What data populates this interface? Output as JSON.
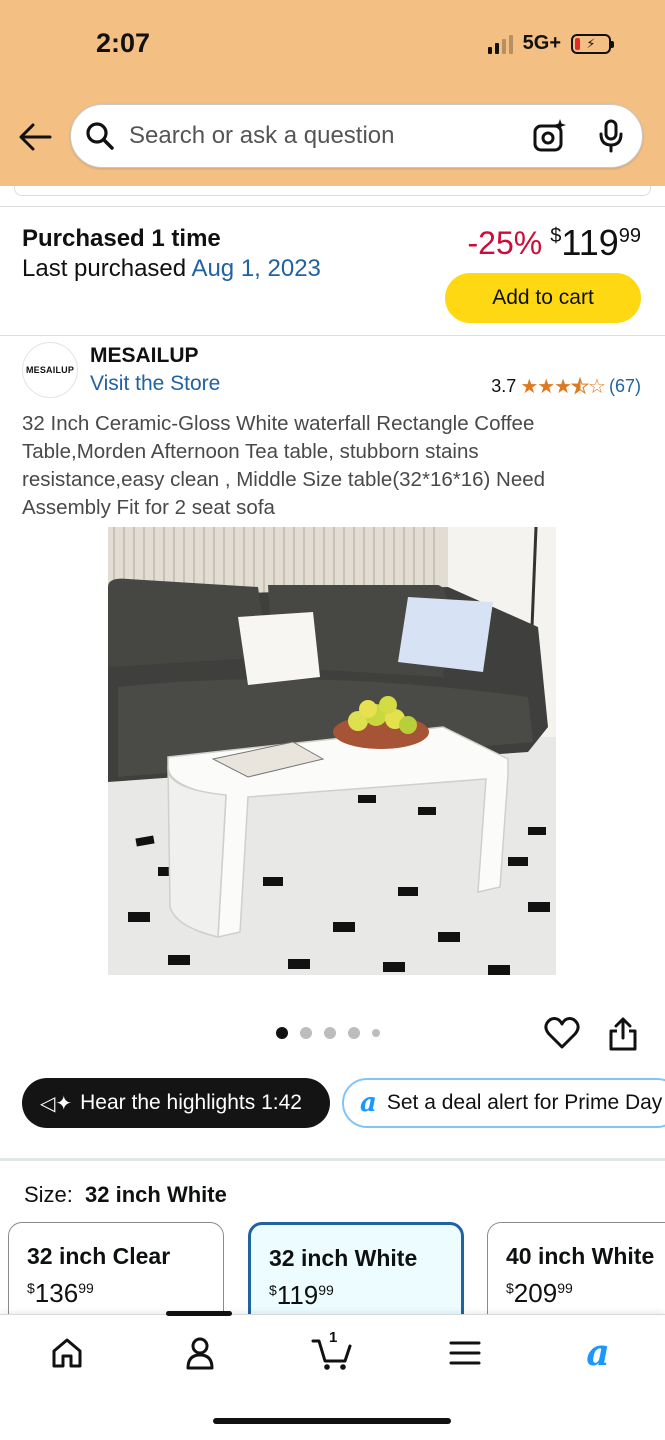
{
  "status_bar": {
    "time": "2:07",
    "network": "5G+",
    "battery_bolt": "⚡"
  },
  "search": {
    "placeholder": "Search or ask a question"
  },
  "purchase": {
    "title": "Purchased 1 time",
    "last_label": "Last purchased",
    "last_date": "Aug 1, 2023",
    "discount": "-25%",
    "currency": "$",
    "price_whole": "119",
    "price_fraction": "99",
    "add_to_cart": "Add to cart"
  },
  "store": {
    "logo_text": "MESAILUP",
    "brand": "MESAILUP",
    "visit_link": "Visit the Store",
    "rating": "3.7",
    "rating_value": 3.7,
    "stars_full": "★★★",
    "stars_half": "★",
    "stars_empty": "☆",
    "review_count": "(67)"
  },
  "product": {
    "title": "32 Inch Ceramic-Gloss White waterfall Rectangle Coffee Table,Morden Afternoon Tea table, stubborn stains resistance,easy clean , Middle Size table(32*16*16) Need Assembly Fit for 2 seat sofa",
    "image_count": 5,
    "active_image": 1
  },
  "actions": {
    "hear_icon": "◁✦",
    "hear_highlights": "Hear the highlights 1:42",
    "deal_icon": "a",
    "deal_alert": "Set a deal alert for Prime Day"
  },
  "size": {
    "label": "Size:",
    "selected": "32 inch White",
    "options": [
      {
        "name": "32 inch Clear",
        "currency": "$",
        "whole": "136",
        "fraction": "99"
      },
      {
        "name": "32 inch White",
        "currency": "$",
        "whole": "119",
        "fraction": "99"
      },
      {
        "name": "40 inch White",
        "currency": "$",
        "whole": "209",
        "fraction": "99"
      }
    ]
  },
  "nav": {
    "cart_count": "1",
    "rufus_label": "a"
  },
  "colors": {
    "header": "#f3bf83",
    "link": "#2162a1",
    "deal": "#cc0c39",
    "cart_button": "#ffd814",
    "rufus": "#1a98ff"
  }
}
